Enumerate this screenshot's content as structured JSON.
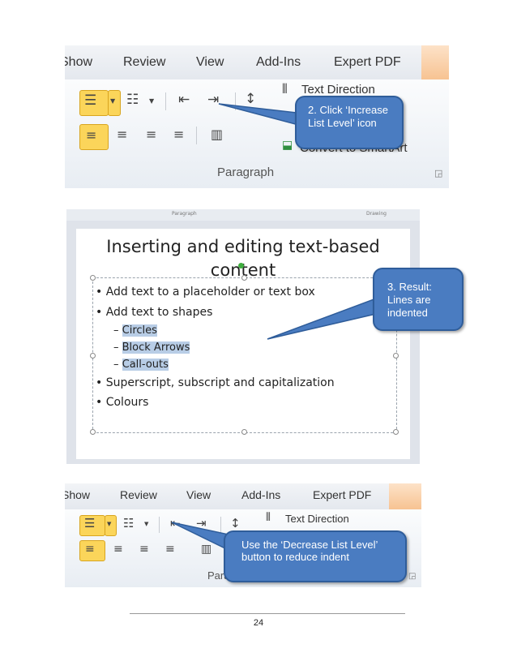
{
  "screenshot1": {
    "tabs": [
      "Show",
      "Review",
      "View",
      "Add-Ins",
      "Expert PDF"
    ],
    "text_direction": "Text Direction",
    "convert_to_smartart": "Convert to SmartArt",
    "group_label": "Paragraph",
    "callout": "2. Click ‘Increase List Level’ icon"
  },
  "slide": {
    "ribbon_labels": [
      "Paragraph",
      "Drawing"
    ],
    "title_line1": "Inserting and editing text-based",
    "title_line2": "content",
    "bullets": [
      "Add text to a placeholder or text box",
      "Add text to shapes"
    ],
    "sub_items": [
      "Circles",
      "Block Arrows",
      "Call-outs"
    ],
    "bullets_after": [
      "Superscript, subscript and capitalization",
      "Colours"
    ],
    "callout": "3. Result: Lines are indented"
  },
  "screenshot3": {
    "tabs": [
      "Show",
      "Review",
      "View",
      "Add-Ins",
      "Expert PDF"
    ],
    "text_direction": "Text Direction",
    "group_label": "Paragraph",
    "callout": "Use the ‘Decrease List Level’ button to reduce indent"
  },
  "page_number": "24",
  "icons": [
    "bullets-icon",
    "numbering-icon",
    "decrease-indent-icon",
    "increase-indent-icon",
    "line-spacing-icon",
    "text-direction-icon",
    "align-left-icon",
    "center-icon",
    "align-right-icon",
    "justify-icon",
    "columns-icon",
    "smartart-icon",
    "dialog-launcher-icon"
  ],
  "colors": {
    "callout_fill": "#4a7cc1",
    "highlight": "#fbd55a",
    "selection": "#b8cde6"
  }
}
